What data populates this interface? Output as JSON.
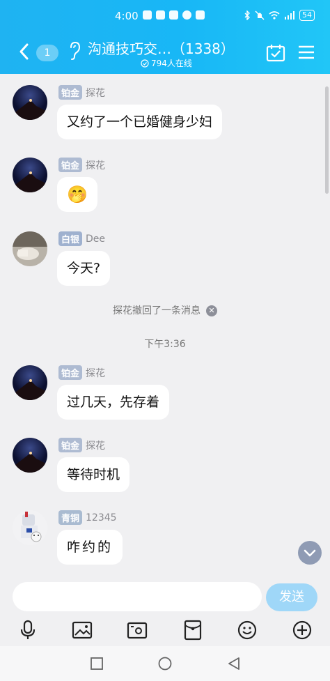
{
  "status_bar": {
    "time": "4:00",
    "battery": "54"
  },
  "header": {
    "unread_badge": "1",
    "group_title": "沟通技巧交…（1338）",
    "online_text": "794人在线"
  },
  "messages": [
    {
      "level": "铂金",
      "username": "探花",
      "text": "又约了一个已婚健身少妇"
    },
    {
      "level": "铂金",
      "username": "探花",
      "text": "🤭"
    },
    {
      "level": "白银",
      "username": "Dee",
      "text": "今天?"
    },
    {
      "level": "铂金",
      "username": "探花",
      "text": "过几天，先存着"
    },
    {
      "level": "铂金",
      "username": "探花",
      "text": "等待时机"
    },
    {
      "level": "青铜",
      "username": "12345",
      "text": "咋约的"
    }
  ],
  "system": {
    "recall_text": "探花撤回了一条消息",
    "time_divider": "下午3:36"
  },
  "input": {
    "placeholder": "",
    "send_label": "发送"
  },
  "icons": {
    "header": [
      "back-icon",
      "ear-icon",
      "calendar-check-icon",
      "menu-icon"
    ],
    "toolbar": [
      "microphone-icon",
      "image-icon",
      "camera-icon",
      "red-packet-icon",
      "emoji-icon",
      "plus-icon"
    ],
    "navbar": [
      "square-icon",
      "circle-icon",
      "triangle-back-icon"
    ]
  },
  "colors": {
    "header_bg": "#1fb3f2",
    "send_button": "#9fd7f8",
    "chat_bg": "#f0f0f2"
  }
}
